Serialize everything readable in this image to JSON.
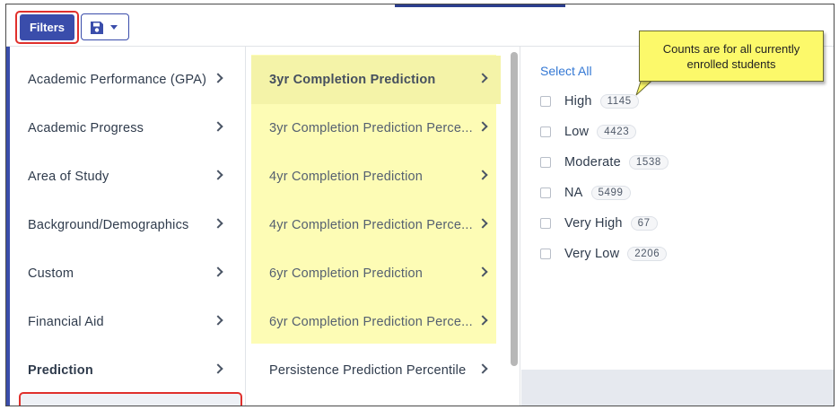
{
  "toolbar": {
    "filters_label": "Filters",
    "save_icon": "save-disk-icon",
    "caret_icon": "caret-down-icon"
  },
  "categories": [
    {
      "label": "Academic Performance (GPA)"
    },
    {
      "label": "Academic Progress"
    },
    {
      "label": "Area of Study"
    },
    {
      "label": "Background/Demographics"
    },
    {
      "label": "Custom"
    },
    {
      "label": "Financial Aid"
    },
    {
      "label": "Prediction"
    }
  ],
  "subcategories": [
    {
      "label": "3yr Completion Prediction"
    },
    {
      "label": "3yr Completion Prediction Perce..."
    },
    {
      "label": "4yr Completion Prediction"
    },
    {
      "label": "4yr Completion Prediction Perce..."
    },
    {
      "label": "6yr Completion Prediction"
    },
    {
      "label": "6yr Completion Prediction Perce..."
    },
    {
      "label": "Persistence Prediction Percentile"
    }
  ],
  "options_panel": {
    "select_all": "Select All",
    "options": [
      {
        "label": "High",
        "count": "1145"
      },
      {
        "label": "Low",
        "count": "4423"
      },
      {
        "label": "Moderate",
        "count": "1538"
      },
      {
        "label": "NA",
        "count": "5499"
      },
      {
        "label": "Very High",
        "count": "67"
      },
      {
        "label": "Very Low",
        "count": "2206"
      }
    ]
  },
  "tooltip": {
    "line1": "Counts are for all currently",
    "line2": "enrolled students"
  },
  "colors": {
    "accent": "#3a4dab",
    "highlight_red": "#e0302c",
    "highlight_yellow": "#fdfcb5",
    "link_blue": "#3478d4",
    "tooltip_yellow": "#fcf96a"
  }
}
